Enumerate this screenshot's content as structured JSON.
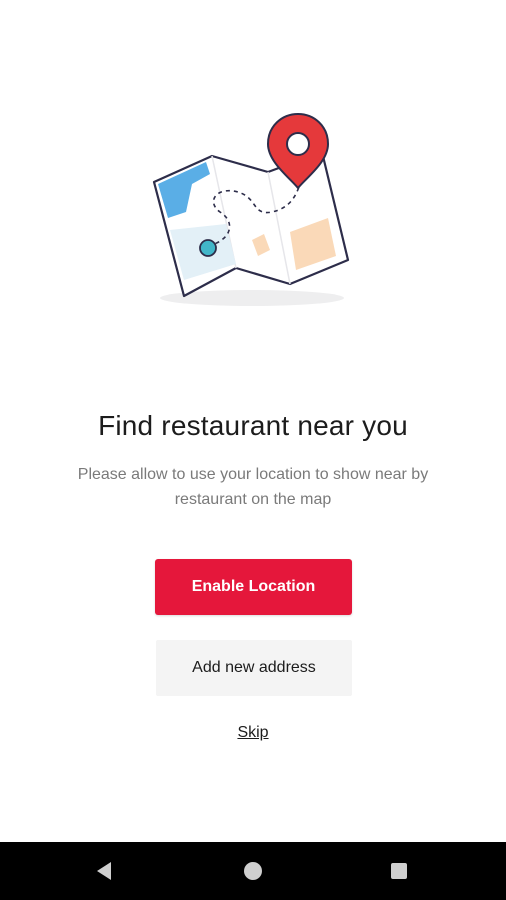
{
  "onboarding": {
    "title": "Find restaurant near you",
    "subtitle": "Please allow to use your location to show near by restaurant on the map",
    "enable_location_label": "Enable Location",
    "add_address_label": "Add new address",
    "skip_label": "Skip"
  },
  "illustration": {
    "icon": "map-pin-icon"
  },
  "colors": {
    "primary": "#e5173b",
    "secondary_bg": "#f4f4f4",
    "title_text": "#1c1c1c",
    "subtitle_text": "#7a7a7a",
    "map_water": "#5aaee6",
    "map_park": "#e3f0f7",
    "map_building": "#fad9b8",
    "map_dot": "#42b6c9",
    "navbar_bg": "#000000"
  },
  "navbar": {
    "back_icon": "back-triangle-icon",
    "home_icon": "home-circle-icon",
    "recents_icon": "recents-square-icon"
  }
}
